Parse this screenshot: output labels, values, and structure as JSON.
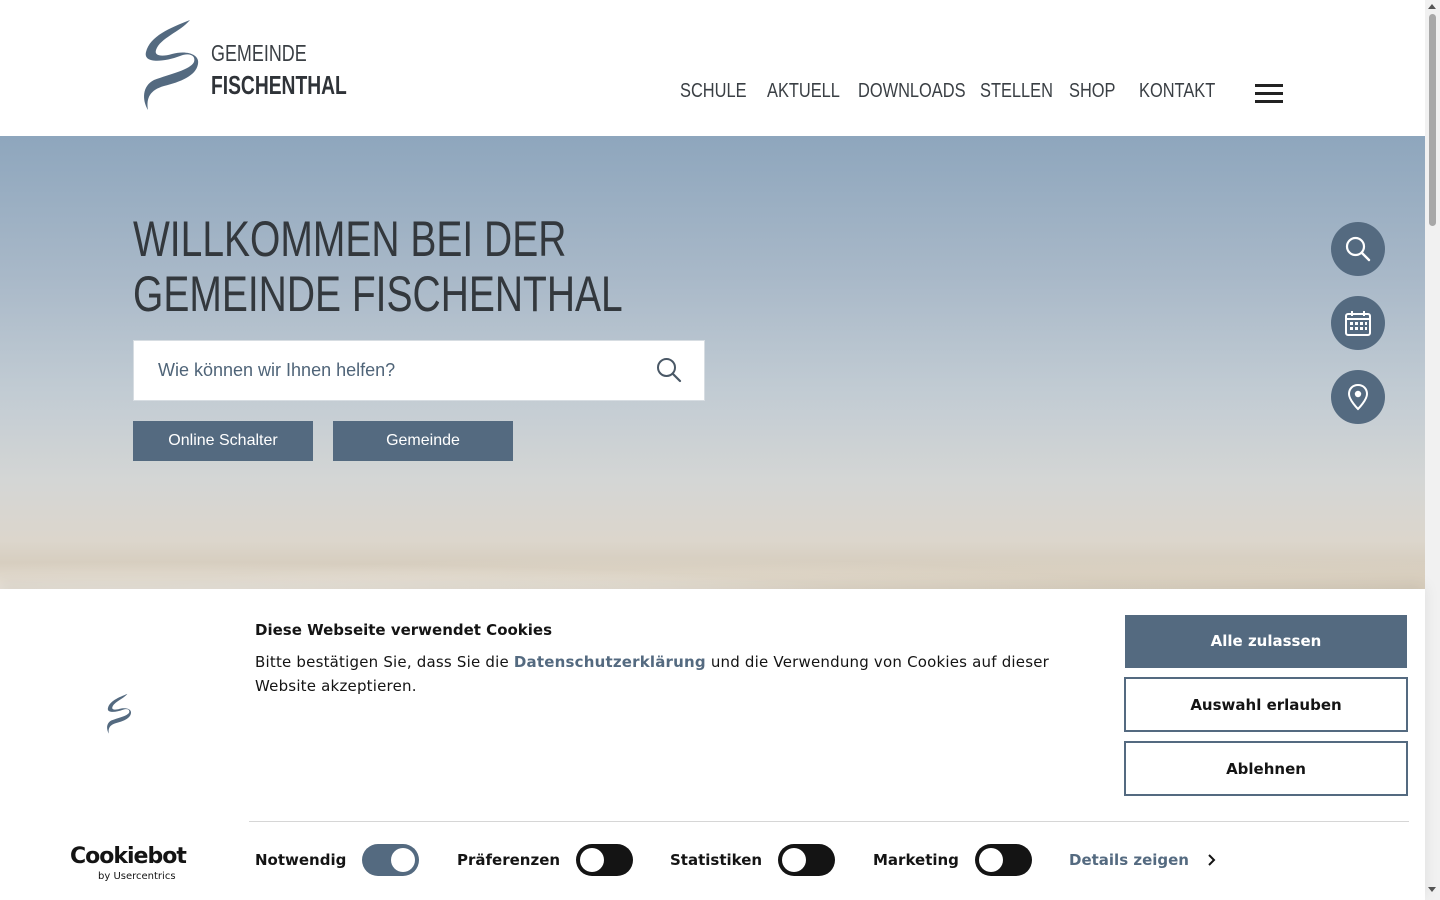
{
  "logo": {
    "line1": "GEMEINDE",
    "line2": "FISCHENTHAL"
  },
  "nav": {
    "items": [
      {
        "label": "SCHULE"
      },
      {
        "label": "AKTUELL"
      },
      {
        "label": "DOWNLOADS"
      },
      {
        "label": "STELLEN"
      },
      {
        "label": "SHOP"
      },
      {
        "label": "KONTAKT"
      }
    ],
    "menu_icon": "hamburger-menu-icon"
  },
  "hero": {
    "title_line1": "WILLKOMMEN BEI DER",
    "title_line2": "GEMEINDE FISCHENTHAL",
    "search_placeholder": "Wie können wir Ihnen helfen?",
    "buttons": [
      {
        "label": "Online Schalter"
      },
      {
        "label": "Gemeinde"
      }
    ],
    "quick_actions": [
      {
        "icon": "search-icon"
      },
      {
        "icon": "calendar-icon"
      },
      {
        "icon": "location-pin-icon"
      }
    ]
  },
  "cookie": {
    "title": "Diese Webseite verwendet Cookies",
    "text_before": "Bitte bestätigen Sie, dass Sie die ",
    "link": "Datenschutzerklärung",
    "text_after": " und die Verwendung von Cookies auf dieser Website akzeptieren.",
    "allow_all": "Alle zulassen",
    "allow_selection": "Auswahl erlauben",
    "decline": "Ablehnen",
    "brand": "Cookiebot",
    "brand_sub": "by Usercentrics",
    "toggles": [
      {
        "label": "Notwendig",
        "on": true
      },
      {
        "label": "Präferenzen",
        "on": false
      },
      {
        "label": "Statistiken",
        "on": false
      },
      {
        "label": "Marketing",
        "on": false
      }
    ],
    "details": "Details zeigen"
  },
  "colors": {
    "accent": "#546a80",
    "text": "#141414",
    "heading": "#33383d"
  }
}
